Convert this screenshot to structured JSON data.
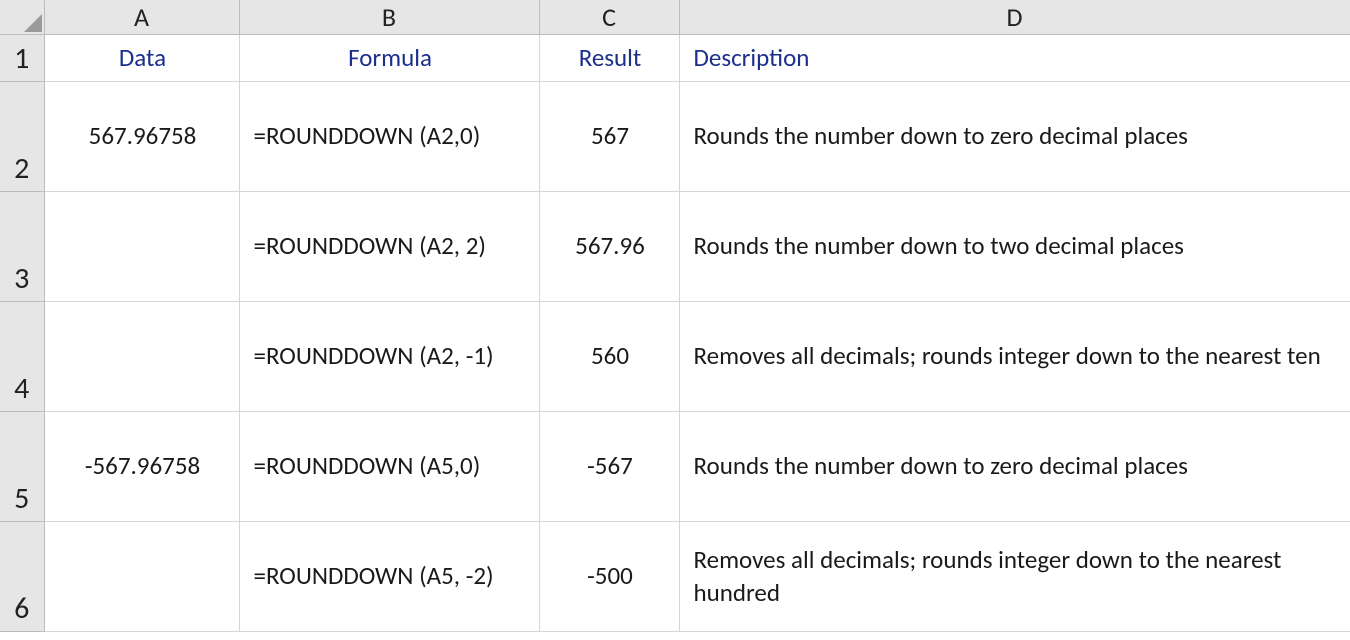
{
  "columns": {
    "A": "A",
    "B": "B",
    "C": "C",
    "D": "D"
  },
  "row_numbers": [
    "1",
    "2",
    "3",
    "4",
    "5",
    "6"
  ],
  "header_row": {
    "data": "Data",
    "formula": "Formula",
    "result": "Result",
    "description": "Description"
  },
  "rows": [
    {
      "data": "567.96758",
      "formula": "=ROUNDDOWN (A2,0)",
      "result": "567",
      "description": "Rounds the number down to zero decimal places"
    },
    {
      "data": "",
      "formula": "=ROUNDDOWN (A2, 2)",
      "result": "567.96",
      "description": "Rounds the number down to two decimal places"
    },
    {
      "data": "",
      "formula": "=ROUNDDOWN (A2, -1)",
      "result": "560",
      "description": "Removes all decimals; rounds integer down to the nearest ten"
    },
    {
      "data": "-567.96758",
      "formula": "=ROUNDDOWN (A5,0)",
      "result": "-567",
      "description": "Rounds the number down to zero decimal places"
    },
    {
      "data": "",
      "formula": "=ROUNDDOWN (A5, -2)",
      "result": "-500",
      "description": "Removes all decimals; rounds integer down to the nearest hundred"
    }
  ]
}
